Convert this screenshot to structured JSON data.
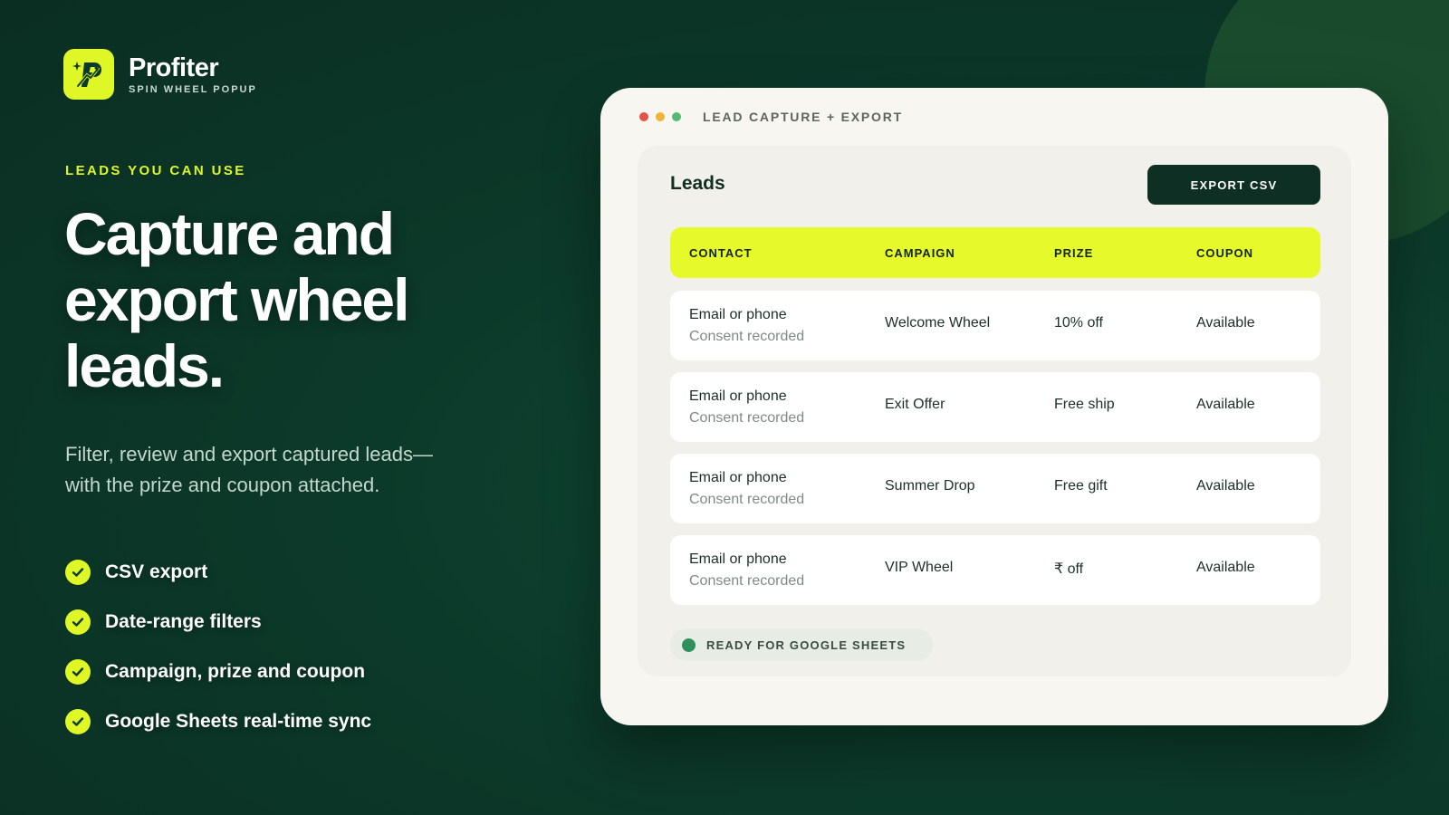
{
  "brand": {
    "name": "Profiter",
    "tagline": "SPIN WHEEL POPUP"
  },
  "hero": {
    "eyebrow": "LEADS YOU CAN USE",
    "headline": "Capture and export wheel leads.",
    "subtext": "Filter, review and export captured leads—with the prize and coupon attached."
  },
  "features": [
    {
      "label": "CSV export",
      "icon": "check-icon"
    },
    {
      "label": "Date-range filters",
      "icon": "check-icon"
    },
    {
      "label": "Campaign, prize and coupon",
      "icon": "check-icon"
    },
    {
      "label": "Google Sheets real-time sync",
      "icon": "check-icon"
    }
  ],
  "window": {
    "title": "LEAD CAPTURE + EXPORT",
    "panel_title": "Leads",
    "export_button": "EXPORT CSV",
    "columns": [
      "CONTACT",
      "CAMPAIGN",
      "PRIZE",
      "COUPON"
    ],
    "rows": [
      {
        "contact": "Email or phone",
        "contact_sub": "Consent recorded",
        "campaign": "Welcome Wheel",
        "prize": "10% off",
        "coupon": "Available"
      },
      {
        "contact": "Email or phone",
        "contact_sub": "Consent recorded",
        "campaign": "Exit Offer",
        "prize": "Free ship",
        "coupon": "Available"
      },
      {
        "contact": "Email or phone",
        "contact_sub": "Consent recorded",
        "campaign": "Summer Drop",
        "prize": "Free gift",
        "coupon": "Available"
      },
      {
        "contact": "Email or phone",
        "contact_sub": "Consent recorded",
        "campaign": "VIP Wheel",
        "prize": "₹ off",
        "coupon": "Available"
      }
    ],
    "status": "READY FOR GOOGLE SHEETS"
  },
  "colors": {
    "accent": "#dff726",
    "background": "#0c3a2a",
    "card": "#f8f6f0",
    "button": "#0e2f23",
    "status_dot": "#2e8f5c"
  }
}
